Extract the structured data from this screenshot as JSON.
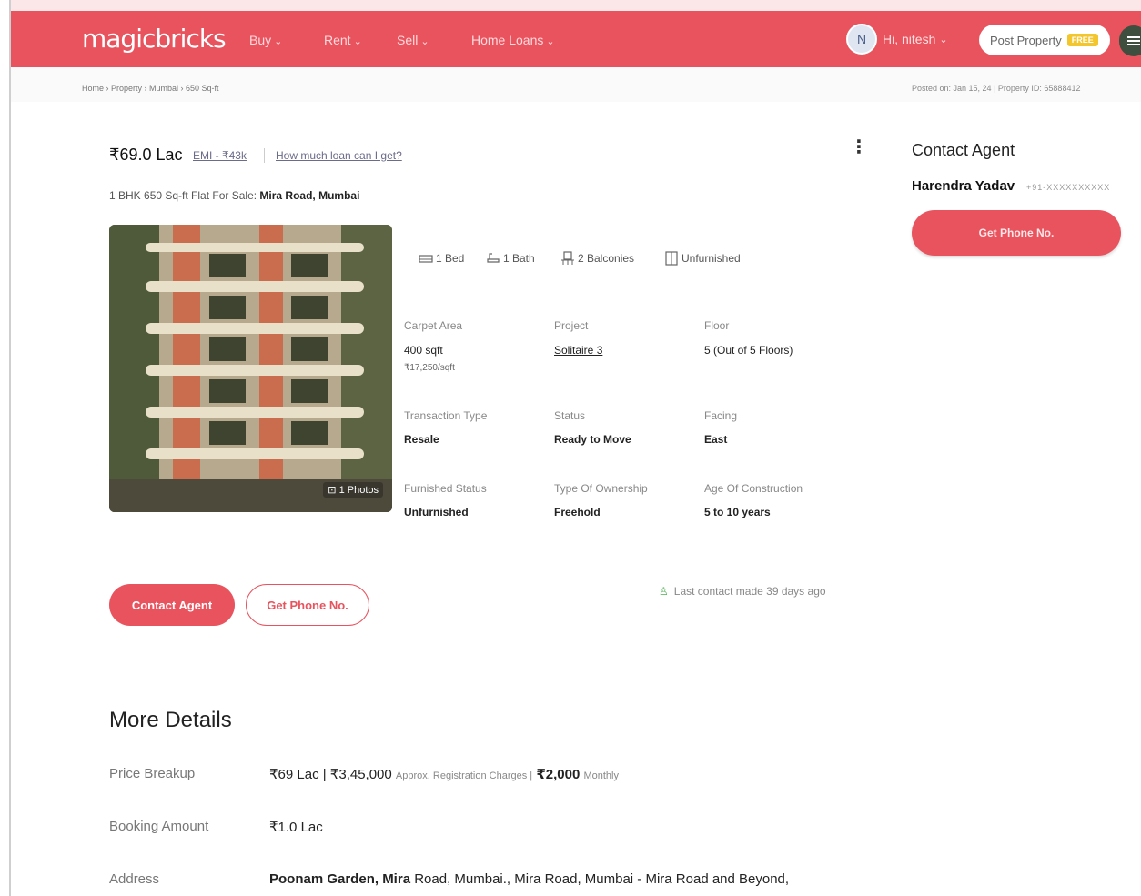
{
  "header": {
    "logo": "magicbricks",
    "nav": [
      {
        "label": "Buy"
      },
      {
        "label": "Rent"
      },
      {
        "label": "Sell"
      },
      {
        "label": "Home Loans"
      }
    ],
    "user_initial": "N",
    "user_name": "Hi, nitesh",
    "post_property": "Post Property",
    "free_badge": "FREE"
  },
  "breadcrumb": "Home › Property › Mumbai › 650 Sq-ft",
  "posted": "Posted on: Jan 15, 24   |   Property ID: 65888412",
  "listing": {
    "price": "₹69.0 Lac",
    "emi": "EMI - ₹43k",
    "loan_link": "How much loan can I get?",
    "subtitle_prefix": "1 BHK 650 Sq-ft Flat For Sale",
    "subtitle_location": "Mira Road, Mumbai",
    "photo_count": "1 Photos",
    "amenities": [
      {
        "label": "1 Bed",
        "icon": "bed-icon"
      },
      {
        "label": "1 Bath",
        "icon": "bath-icon"
      },
      {
        "label": "2 Balconies",
        "icon": "balcony-icon"
      },
      {
        "label": "Unfurnished",
        "icon": "furnishing-icon"
      }
    ],
    "details": [
      {
        "label": "Carpet Area",
        "value": "400 sqft",
        "sub": "₹17,250/sqft"
      },
      {
        "label": "Project",
        "value": "Solitaire 3"
      },
      {
        "label": "Floor",
        "value": "5 (Out of 5 Floors)"
      },
      {
        "label": "Transaction Type",
        "value": "Resale"
      },
      {
        "label": "Status",
        "value": "Ready to Move"
      },
      {
        "label": "Facing",
        "value": "East"
      },
      {
        "label": "Furnished Status",
        "value": "Unfurnished"
      },
      {
        "label": "Type Of Ownership",
        "value": "Freehold"
      },
      {
        "label": "Age Of Construction",
        "value": "5 to 10 years"
      }
    ],
    "contact_agent_btn": "Contact Agent",
    "get_phone_btn": "Get Phone No.",
    "last_contact": "Last contact made 39 days ago"
  },
  "agent": {
    "title": "Contact Agent",
    "name": "Harendra Yadav",
    "phone": "+91-XXXXXXXXXX",
    "button": "Get Phone No."
  },
  "more_details": {
    "title": "More Details",
    "rows": [
      {
        "label": "Price Breakup",
        "value": "₹69 Lac | ₹3,45,000",
        "note": "Approx. Registration Charges |",
        "extra": "₹2,000",
        "extra_note": "Monthly"
      },
      {
        "label": "Booking Amount",
        "value": "₹1.0 Lac"
      },
      {
        "label": "Address",
        "value_bold": "Poonam Garden, Mira",
        "value": " Road, Mumbai., Mira Road, Mumbai - Mira Road and Beyond,"
      }
    ]
  },
  "colors": {
    "brand": "#e8535e",
    "badge": "#f3c62d"
  }
}
